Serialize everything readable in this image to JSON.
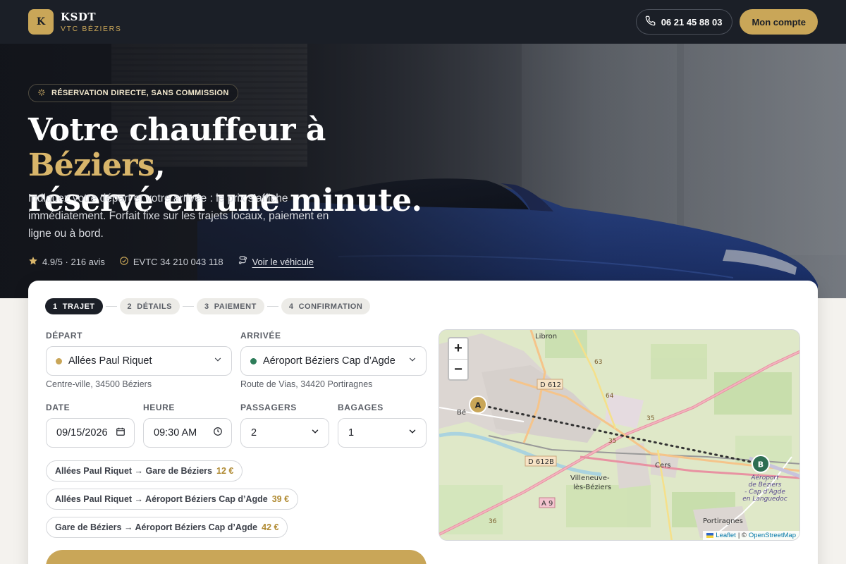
{
  "brand": {
    "logo_letter": "K",
    "name": "KSDT",
    "tagline": "VTC BÉZIERS"
  },
  "header": {
    "phone": "06 21 45 88 03",
    "account_label": "Mon compte"
  },
  "hero": {
    "badge": "RÉSERVATION DIRECTE, SANS COMMISSION",
    "title_part1": "Votre chauffeur à ",
    "title_accent": "Béziers",
    "title_part2": ",",
    "title_line2": "réservé en une minute.",
    "description": "Indiquez votre départ et votre arrivée : le prix s’affiche immédiatement. Forfait fixe sur les trajets locaux, paiement en ligne ou à bord.",
    "rating": "4.9/5 · 216 avis",
    "license": "EVTC 34 210 043 118",
    "vehicle_link": "Voir le véhicule"
  },
  "steps": [
    {
      "number": "1",
      "label": "TRAJET"
    },
    {
      "number": "2",
      "label": "DÉTAILS"
    },
    {
      "number": "3",
      "label": "PAIEMENT"
    },
    {
      "number": "4",
      "label": "CONFIRMATION"
    }
  ],
  "form": {
    "departure_label": "DÉPART",
    "departure_value": "Allées Paul Riquet",
    "departure_address": "Centre-ville, 34500 Béziers",
    "arrival_label": "ARRIVÉE",
    "arrival_value": "Aéroport Béziers Cap d’Agde",
    "arrival_address": "Route de Vias, 34420 Portiragnes",
    "date_label": "DATE",
    "date_value": "09/15/2026",
    "time_label": "HEURE",
    "time_value": "09:30 AM",
    "passengers_label": "PASSAGERS",
    "passengers_value": "2",
    "luggage_label": "BAGAGES",
    "luggage_value": "1"
  },
  "quick_routes": [
    {
      "route": "Allées Paul Riquet → Gare de Béziers",
      "price": "12 €"
    },
    {
      "route": "Allées Paul Riquet → Aéroport Béziers Cap d’Agde",
      "price": "39 €"
    },
    {
      "route": "Gare de Béziers → Aéroport Béziers Cap d’Agde",
      "price": "42 €"
    }
  ],
  "map": {
    "zoom_in": "+",
    "zoom_out": "−",
    "marker_a": "A",
    "marker_b": "B",
    "labels": {
      "libron": "Libron",
      "beziers": "Bé",
      "d612": "D 612",
      "d612b": "D 612B",
      "a9": "A 9",
      "cers": "Cers",
      "villeneuve1": "Villeneuve-",
      "villeneuve2": "lès-Béziers",
      "portiragnes": "Portiragnes",
      "airport1": "Aéroport",
      "airport2": "de Béziers",
      "airport3": "- Cap d'Agde",
      "airport4": "en Languedoc",
      "r63": "63",
      "r64": "64",
      "r35a": "35",
      "r35b": "35",
      "r36": "36"
    },
    "attribution_leaflet": "Leaflet",
    "attribution_sep": "| ©",
    "attribution_osm": "OpenStreetMap"
  },
  "colors": {
    "gold": "#c9a658",
    "dark": "#1b1f27",
    "departure_dot": "#c9a658",
    "arrival_dot": "#2e7d5a"
  }
}
